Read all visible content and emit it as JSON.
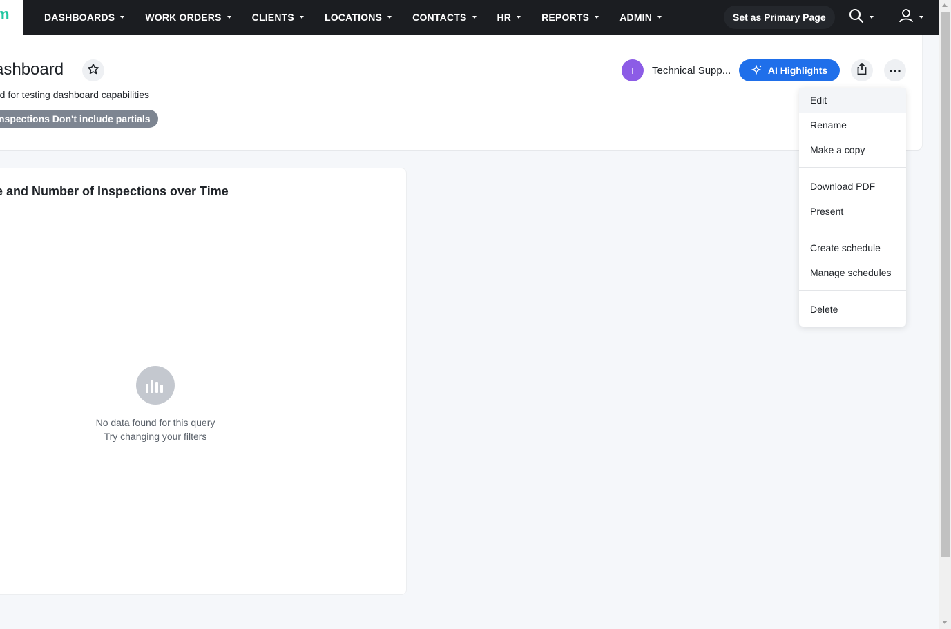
{
  "nav": {
    "items": [
      {
        "label": "DASHBOARDS"
      },
      {
        "label": "WORK ORDERS"
      },
      {
        "label": "CLIENTS"
      },
      {
        "label": "LOCATIONS"
      },
      {
        "label": "CONTACTS"
      },
      {
        "label": "HR"
      },
      {
        "label": "REPORTS"
      },
      {
        "label": "ADMIN"
      }
    ],
    "primary_button": "Set as Primary Page",
    "search_icon": "search-icon",
    "user_icon": "user-icon"
  },
  "header": {
    "title": "ashboard",
    "description": "rd for testing dashboard capabilities",
    "filter_chip": "nspections Don't include partials",
    "owner_initial": "T",
    "owner_name": "Technical Supp...",
    "ai_button": "AI Highlights"
  },
  "chart_card": {
    "title": "e and Number of Inspections over Time",
    "empty_main": "No data found for this query",
    "empty_sub": "Try changing your filters"
  },
  "menu": {
    "items": [
      {
        "label": "Edit"
      },
      {
        "label": "Rename"
      },
      {
        "label": "Make a copy"
      },
      {
        "label": "Download PDF"
      },
      {
        "label": "Present"
      },
      {
        "label": "Create schedule"
      },
      {
        "label": "Manage schedules"
      },
      {
        "label": "Delete"
      }
    ]
  },
  "colors": {
    "navbar": "#1b1d21",
    "accent": "#1f6fea",
    "avatar": "#8c5ce6",
    "logo": "#1fc6a0"
  }
}
